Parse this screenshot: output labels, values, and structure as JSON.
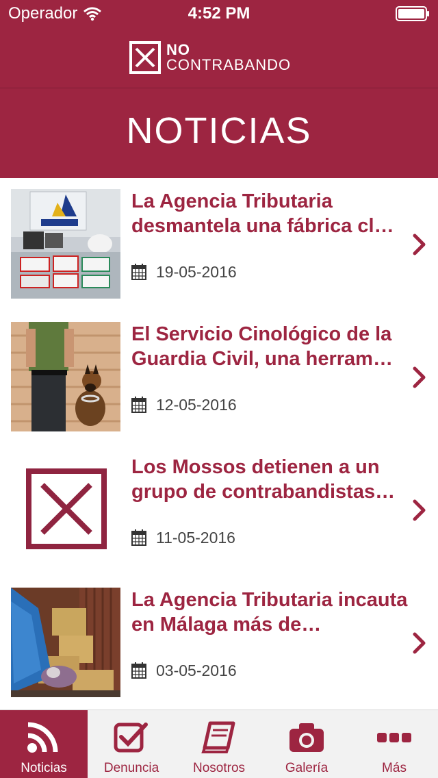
{
  "status_bar": {
    "carrier": "Operador",
    "time": "4:52 PM"
  },
  "logo": {
    "line1": "NO",
    "line2": "CONTRABANDO"
  },
  "page": {
    "title": "NOTICIAS"
  },
  "colors": {
    "brand": "#9d2541",
    "tab_bg": "#f2f2f2",
    "text_dark": "#444444"
  },
  "news": [
    {
      "title": "La Agencia Tributaria desmantela una fábrica cl…",
      "date": "19-05-2016",
      "thumb": "customs-seizure-photo"
    },
    {
      "title": "El Servicio Cinológico de la Guardia Civil, una herram…",
      "date": "12-05-2016",
      "thumb": "guard-dog-photo"
    },
    {
      "title": "Los Mossos detienen a un grupo de contrabandistas…",
      "date": "11-05-2016",
      "thumb": "no-contrabando-placeholder"
    },
    {
      "title": "La Agencia Tributaria incauta en Málaga más de…",
      "date": "03-05-2016",
      "thumb": "warehouse-photo"
    }
  ],
  "tabs": [
    {
      "label": "Noticias",
      "icon": "rss-icon",
      "active": true
    },
    {
      "label": "Denuncia",
      "icon": "checkbox-icon",
      "active": false
    },
    {
      "label": "Nosotros",
      "icon": "book-icon",
      "active": false
    },
    {
      "label": "Galería",
      "icon": "camera-icon",
      "active": false
    },
    {
      "label": "Más",
      "icon": "more-icon",
      "active": false
    }
  ]
}
